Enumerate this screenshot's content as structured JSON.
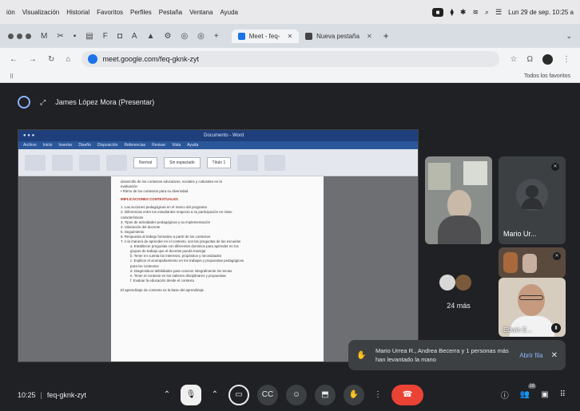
{
  "menubar": {
    "items": [
      "ión",
      "Visualización",
      "Historial",
      "Favoritos",
      "Perfiles",
      "Pestaña",
      "Ventana",
      "Ayuda"
    ],
    "datetime": "Lun 29 de sep. 10:25 a"
  },
  "browser": {
    "tabs": [
      {
        "label": "Meet - feq-",
        "active": true
      },
      {
        "label": "Nueva pestaña",
        "active": false
      }
    ],
    "url": "meet.google.com/feq-gknk-zyt",
    "bookmarks_all": "Todos los favoritos"
  },
  "meet": {
    "presenter_label": "James López Mora (Presentar)",
    "meeting_time": "10:25",
    "meeting_code": "feq-gknk-zyt",
    "participants": [
      {
        "name": "Mario Ur..."
      },
      {
        "name": "Edwin E..."
      }
    ],
    "more_count": "24 más",
    "notification": {
      "message": "Mario Urrea R., Andrea Becerra y 1 personas más han levantado la mano",
      "action": "Abrir fila"
    }
  },
  "document": {
    "heading": "IMPLICACIONES CONTEXTUALES",
    "lines": [
      "desarrollo de los contextos educativos, sociales y culturales en la",
      "evaluación",
      "• Ritmo de los contextos para su diversidad",
      "1. Las acciones pedagógicas en el marco del programa",
      "2. Diferencias entre los estudiantes respecto a su participación en clase",
      "   características",
      "3. Tipos de actividades pedagógicas y su implementación",
      "4. Valoración del docente",
      "5. Seguimiento",
      "6. Respuesta al trabajo formativo a partir de los contextos",
      "7. A la manera de aprender en el contexto, son las preguntas de las escuelas",
      "   a. Establecer preguntas con diferentes dominios para aprender en los",
      "      grupos de trabajo que el docente pueda manejar",
      "   b. Tener en cuenta los intereses, propósitos y necesidades",
      "   c. Explicar el acompañamiento en los trabajos y propuestas pedagógicas",
      "      para los contextos",
      "   d. Diagnosticar debilidades para conocer integralmente los temas",
      "   e. Tener el contexto en los saberes disciplinares y propuestas",
      "   f. Evaluar la educación desde el contexto",
      "El aprendizaje de contexto es la base del aprendizaje"
    ],
    "window_title": "Documento - Word",
    "style_labels": [
      "Normal",
      "Sin espaciado",
      "Título 1"
    ]
  }
}
